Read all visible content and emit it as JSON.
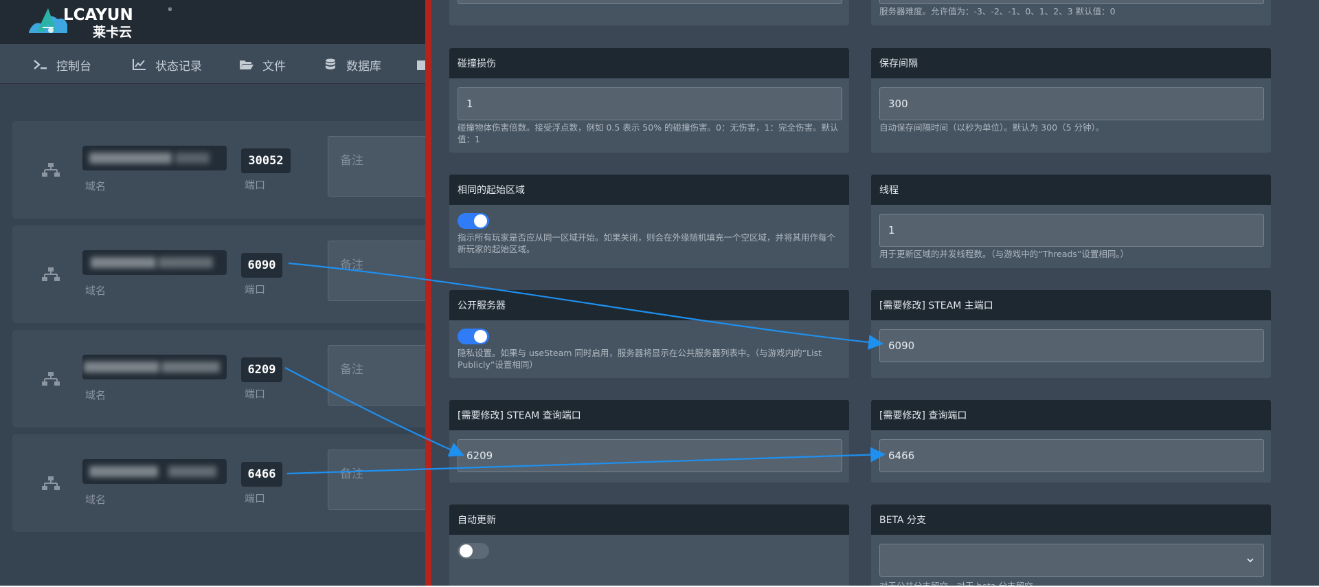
{
  "brand": {
    "name_en": "LCAYUN",
    "name_cn": "莱卡云",
    "tm": "®"
  },
  "nav": [
    {
      "label": "控制台",
      "icon": "terminal-icon"
    },
    {
      "label": "状态记录",
      "icon": "line-chart-icon"
    },
    {
      "label": "文件",
      "icon": "folder-open-icon"
    },
    {
      "label": "数据库",
      "icon": "database-icon"
    }
  ],
  "ports": {
    "domain_label": "域名",
    "port_label": "端口",
    "note_placeholder": "备注",
    "items": [
      {
        "port": "30052"
      },
      {
        "port": "6090"
      },
      {
        "port": "6209"
      },
      {
        "port": "6466"
      }
    ]
  },
  "settings": {
    "difficulty_help": "服务器难度。允许值为：-3、-2、-1、0、1、2、3 默认值：0",
    "collision": {
      "title": "碰撞损伤",
      "value": "1",
      "help": "碰撞物体伤害倍数。接受浮点数，例如 0.5 表示 50% 的碰撞伤害。0：无伤害，1：完全伤害。默认值：1"
    },
    "save_interval": {
      "title": "保存间隔",
      "value": "300",
      "help": "自动保存间隔时间（以秒为单位）。默认为 300（5 分钟）。"
    },
    "same_start": {
      "title": "相同的起始区域",
      "enabled": true,
      "help": "指示所有玩家是否应从同一区域开始。如果关闭，则会在外缘随机填充一个空区域，并将其用作每个新玩家的起始区域。"
    },
    "threads": {
      "title": "线程",
      "value": "1",
      "help": "用于更新区域的并发线程数。（与游戏中的“Threads”设置相同。）"
    },
    "public_server": {
      "title": "公开服务器",
      "enabled": true,
      "help": "隐私设置。如果与 useSteam 同时启用，服务器将显示在公共服务器列表中。（与游戏内的“List Publicly”设置相同）"
    },
    "steam_main_port": {
      "title": "[需要修改] STEAM 主端口",
      "value": "6090"
    },
    "steam_query_port": {
      "title": "[需要修改] STEAM 查询端口",
      "value": "6209"
    },
    "query_port": {
      "title": "[需要修改] 查询端口",
      "value": "6466"
    },
    "auto_update": {
      "title": "自动更新",
      "enabled": false
    },
    "beta_branch": {
      "title": "BETA 分支",
      "value": "",
      "help": "对于公共分支留空，对于 beta 分支留空。"
    }
  },
  "colors": {
    "arrow": "#1e90f0",
    "separator": "#b4231c",
    "toggle_on": "#2f7cf6"
  }
}
